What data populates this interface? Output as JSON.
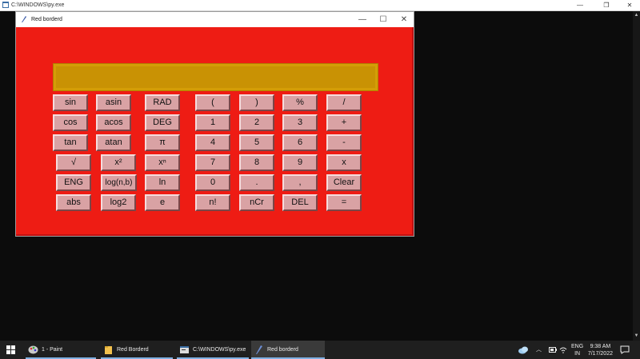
{
  "console": {
    "title": "C:\\WINDOWS\\py.exe"
  },
  "window": {
    "title": "Red borderd",
    "minimize": "—",
    "maximize": "☐",
    "close": "✕"
  },
  "display": {
    "value": ""
  },
  "keys": {
    "sin": "sin",
    "asin": "asin",
    "rad": "RAD",
    "lparen": "(",
    "rparen": ")",
    "percent": "%",
    "divide": "/",
    "cos": "cos",
    "acos": "acos",
    "deg": "DEG",
    "one": "1",
    "two": "2",
    "three": "3",
    "plus": "+",
    "tan": "tan",
    "atan": "atan",
    "pi": "π",
    "four": "4",
    "five": "5",
    "six": "6",
    "minus": "-",
    "sqrt": "√",
    "square": "x²",
    "power": "xⁿ",
    "seven": "7",
    "eight": "8",
    "nine": "9",
    "multiply": "x",
    "eng": "ENG",
    "logb": "log(n,b)",
    "ln": "ln",
    "zero": "0",
    "dot": ".",
    "comma": ",",
    "clear": "Clear",
    "abs": "abs",
    "log2": "log2",
    "e": "e",
    "fact": "n!",
    "ncr": "nCr",
    "del": "DEL",
    "equals": "="
  },
  "taskbar": {
    "items": [
      {
        "label": "1 - Paint"
      },
      {
        "label": "Red Borderd"
      },
      {
        "label": "C:\\WINDOWS\\py.exe"
      },
      {
        "label": "Red borderd"
      }
    ],
    "language": "ENG",
    "region": "IN",
    "time": "9:38 AM",
    "date": "7/17/2022"
  }
}
